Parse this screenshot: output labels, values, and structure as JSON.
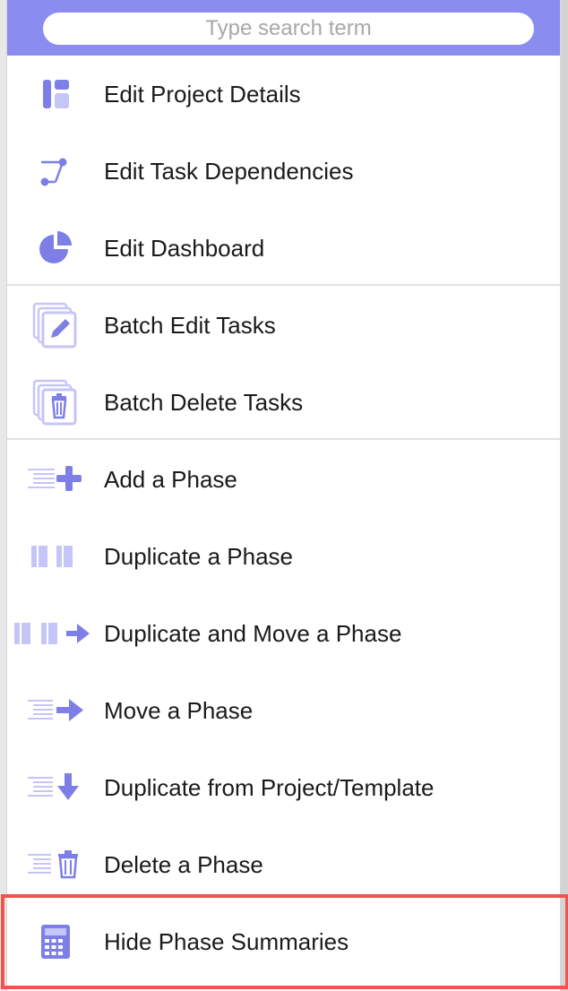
{
  "search": {
    "placeholder": "Type search term",
    "value": ""
  },
  "colors": {
    "accent": "#8a8cf0",
    "icon_dark": "#7d7fe6",
    "icon_light": "#c5c6f7",
    "highlight_border": "#f0554d"
  },
  "menu": {
    "items": [
      {
        "name": "edit-project-details",
        "label": "Edit Project Details",
        "icon": "project-details-icon"
      },
      {
        "name": "edit-task-dependencies",
        "label": "Edit Task Dependencies",
        "icon": "dependencies-icon"
      },
      {
        "name": "edit-dashboard",
        "label": "Edit Dashboard",
        "icon": "pie-chart-icon"
      },
      {
        "name": "batch-edit-tasks",
        "label": "Batch Edit Tasks",
        "icon": "batch-edit-icon"
      },
      {
        "name": "batch-delete-tasks",
        "label": "Batch Delete Tasks",
        "icon": "batch-delete-icon"
      },
      {
        "name": "add-a-phase",
        "label": "Add a Phase",
        "icon": "add-phase-icon"
      },
      {
        "name": "duplicate-a-phase",
        "label": "Duplicate a Phase",
        "icon": "duplicate-phase-icon"
      },
      {
        "name": "duplicate-and-move-a-phase",
        "label": "Duplicate and Move a Phase",
        "icon": "duplicate-move-phase-icon"
      },
      {
        "name": "move-a-phase",
        "label": "Move a Phase",
        "icon": "move-phase-icon"
      },
      {
        "name": "duplicate-from-project-template",
        "label": "Duplicate from Project/Template",
        "icon": "duplicate-from-template-icon"
      },
      {
        "name": "delete-a-phase",
        "label": "Delete a Phase",
        "icon": "delete-phase-icon"
      },
      {
        "name": "hide-phase-summaries",
        "label": "Hide Phase Summaries",
        "icon": "calculator-icon",
        "highlighted": true
      }
    ]
  }
}
